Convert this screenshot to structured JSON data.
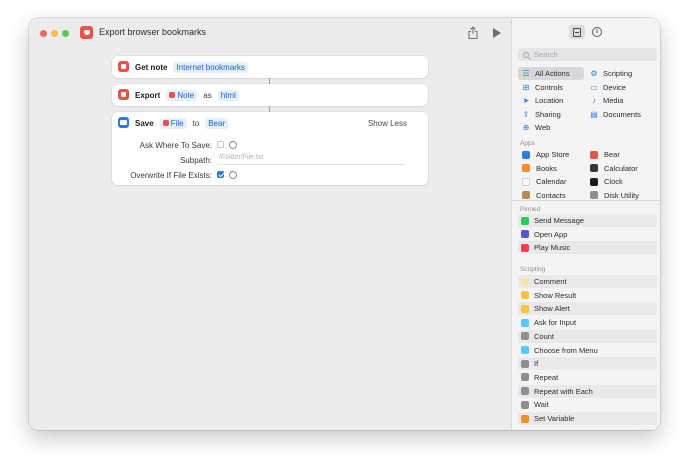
{
  "window": {
    "title": "Export browser bookmarks"
  },
  "actions": [
    {
      "verb": "Get note",
      "param": "Internet bookmarks"
    },
    {
      "verb": "Export",
      "token": "Note",
      "joiner": "as",
      "format": "html"
    },
    {
      "verb": "Save",
      "token": "File",
      "joiner": "to",
      "target": "Bear",
      "toggle_label": "Show Less",
      "params": {
        "ask_where_label": "Ask Where To Save:",
        "subpath_label": "Subpath:",
        "subpath_placeholder": "/Folder/File.txt",
        "overwrite_label": "Overwrite If File Exists:"
      }
    }
  ],
  "sidebar": {
    "search_placeholder": "Search",
    "categories": [
      {
        "label": "All Actions",
        "icon": "list-icon",
        "glyph": "☰"
      },
      {
        "label": "Scripting",
        "icon": "scripting-icon",
        "glyph": "⚙"
      },
      {
        "label": "Controls",
        "icon": "controls-icon",
        "glyph": "⊞"
      },
      {
        "label": "Device",
        "icon": "device-icon",
        "glyph": "▭"
      },
      {
        "label": "Location",
        "icon": "location-icon",
        "glyph": "➤"
      },
      {
        "label": "Media",
        "icon": "media-icon",
        "glyph": "♪"
      },
      {
        "label": "Sharing",
        "icon": "sharing-icon",
        "glyph": "⇪"
      },
      {
        "label": "Documents",
        "icon": "documents-icon",
        "glyph": "▤"
      },
      {
        "label": "Web",
        "icon": "web-icon",
        "glyph": "⊕"
      }
    ],
    "apps_label": "Apps",
    "apps": [
      {
        "label": "App Store",
        "color": "#2f7be0"
      },
      {
        "label": "Bear",
        "color": "#e5534b"
      },
      {
        "label": "Books",
        "color": "#f28f2c"
      },
      {
        "label": "Calculator",
        "color": "#3a3a3c"
      },
      {
        "label": "Calendar",
        "color": "#ffffff"
      },
      {
        "label": "Clock",
        "color": "#1d1d1f"
      },
      {
        "label": "Contacts",
        "color": "#b38b5d"
      },
      {
        "label": "Disk Utility",
        "color": "#8e8e93"
      }
    ],
    "pinned_label": "Pinned",
    "pinned": [
      {
        "label": "Send Message",
        "color": "#34c759"
      },
      {
        "label": "Open App",
        "color": "#5856d6"
      },
      {
        "label": "Play Music",
        "color": "#fa3e55"
      }
    ],
    "scripting_label": "Scripting",
    "scripting": [
      {
        "label": "Comment",
        "color": "#f5e6a8"
      },
      {
        "label": "Show Result",
        "color": "#f5c542"
      },
      {
        "label": "Show Alert",
        "color": "#f5c542"
      },
      {
        "label": "Ask for Input",
        "color": "#5ac8fa"
      },
      {
        "label": "Count",
        "color": "#8e8e93"
      },
      {
        "label": "Choose from Menu",
        "color": "#5ac8fa"
      },
      {
        "label": "If",
        "color": "#8e8e93"
      },
      {
        "label": "Repeat",
        "color": "#8e8e93"
      },
      {
        "label": "Repeat with Each",
        "color": "#8e8e93"
      },
      {
        "label": "Wait",
        "color": "#8e8e93"
      },
      {
        "label": "Set Variable",
        "color": "#f28f2c"
      }
    ]
  }
}
